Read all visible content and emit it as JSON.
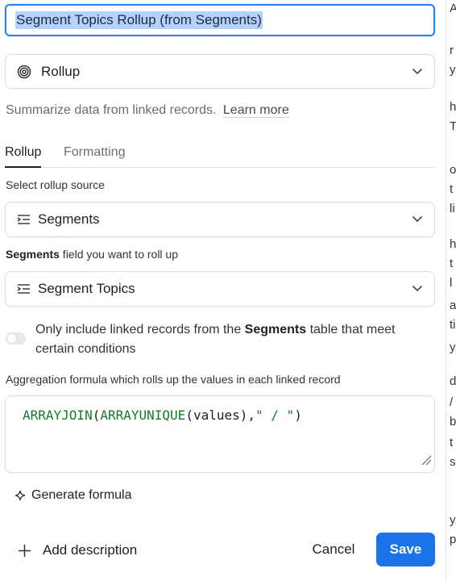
{
  "field_name": {
    "value": "Segment Topics Rollup (from Segments)"
  },
  "field_type": {
    "label": "Rollup",
    "icon": "rollup-spiral-icon"
  },
  "summary": {
    "text": "Summarize data from linked records.",
    "learn_more": "Learn more"
  },
  "tabs": [
    {
      "label": "Rollup",
      "active": true
    },
    {
      "label": "Formatting",
      "active": false
    }
  ],
  "rollup_source": {
    "label": "Select rollup source",
    "value": "Segments",
    "icon": "linked-record-icon"
  },
  "rollup_field": {
    "label_bold": "Segments",
    "label_rest": " field you want to roll up",
    "value": "Segment Topics",
    "icon": "linked-record-icon"
  },
  "condition_toggle": {
    "on": false,
    "text_before": "Only include linked records from the ",
    "text_bold": "Segments",
    "text_after": " table that meet certain conditions"
  },
  "aggregation": {
    "label": "Aggregation formula which rolls up the values in each linked record",
    "formula": {
      "fn1": "ARRAYJOIN",
      "p1": "(",
      "fn2": "ARRAYUNIQUE",
      "p2": "(values),",
      "str": "\" / \"",
      "p3": ")"
    }
  },
  "generate_formula": {
    "label": "Generate formula",
    "icon": "sparkle-icon"
  },
  "footer": {
    "add_description": "Add description",
    "cancel": "Cancel",
    "save": "Save"
  },
  "colors": {
    "accent": "#1a73e8",
    "focus": "#2d7ff9",
    "formula_fn": "#137a2b"
  },
  "side_strip_chars": [
    "A",
    "r",
    "y,",
    "h",
    "T",
    "ol",
    "t",
    "li",
    "h",
    "t",
    "l",
    "a",
    "ti",
    "y,",
    "d",
    "/",
    "b",
    "t",
    "s",
    "y,",
    "p"
  ]
}
